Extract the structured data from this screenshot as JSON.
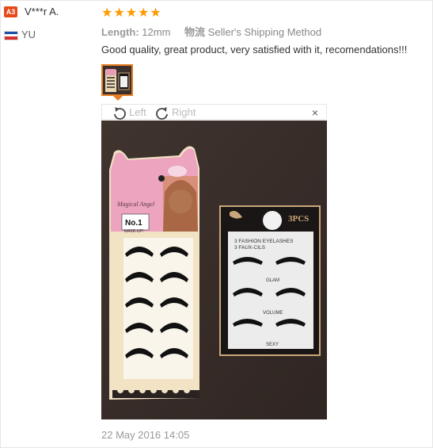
{
  "reviewer": {
    "level_badge": "A3",
    "name": "V***r A.",
    "country_code": "YU",
    "flag_colors": [
      "#1d4fa8",
      "#ffffff",
      "#d32f2f"
    ]
  },
  "review": {
    "star_count": 5,
    "stars_text": "★★★★★",
    "star_color": "#ff9900",
    "attributes": [
      {
        "key": "Length:",
        "value": "12mm"
      },
      {
        "key": "物流",
        "value": "Seller's Shipping Method"
      }
    ],
    "text": "Good quality, great product, very satisfied with it, recomendations!!!",
    "date": "22 May 2016 14:05"
  },
  "viewer": {
    "rotate_left_label": "Left",
    "rotate_right_label": "Right",
    "close_label": "×",
    "accent": "#e67e22"
  },
  "photo": {
    "box_left": {
      "brand": "Magical Angel",
      "model": "No.1",
      "sub": "MAKE-UP!"
    },
    "box_right": {
      "pcs": "3PCS",
      "line1": "3 FASHION EYELASHES",
      "line2": "3 FAUX-CILS",
      "labels": [
        "GLAM",
        "VOLUME",
        "SEXY"
      ]
    }
  }
}
